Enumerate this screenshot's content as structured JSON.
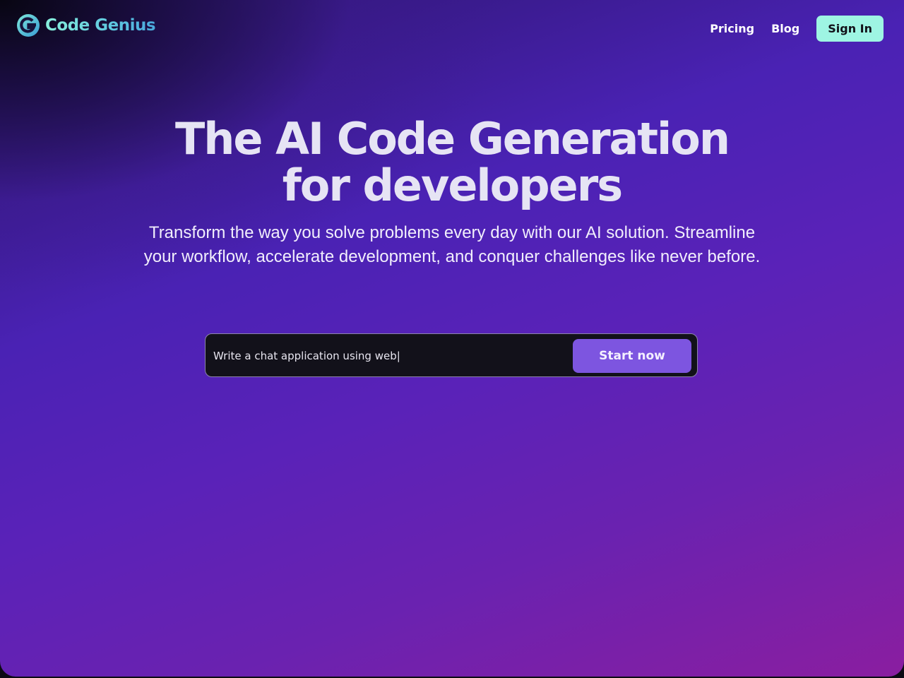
{
  "brand": {
    "name": "Code Genius",
    "logo_icon": "code-genius-g-logo-icon"
  },
  "nav": {
    "links": [
      {
        "label": "Pricing"
      },
      {
        "label": "Blog"
      }
    ],
    "signin_label": "Sign In"
  },
  "hero": {
    "title_line1": "The AI Code Generation",
    "title_line2": "for developers",
    "subtitle": "Transform the way you solve problems every day with our AI solution. Streamline your workflow, accelerate development, and conquer challenges like never before."
  },
  "prompt": {
    "value": "Write a chat application using web|",
    "button_label": "Start now"
  },
  "colors": {
    "accent_mint": "#9ef5e3",
    "accent_purple": "#7d55e0",
    "input_bg": "#12111a"
  }
}
